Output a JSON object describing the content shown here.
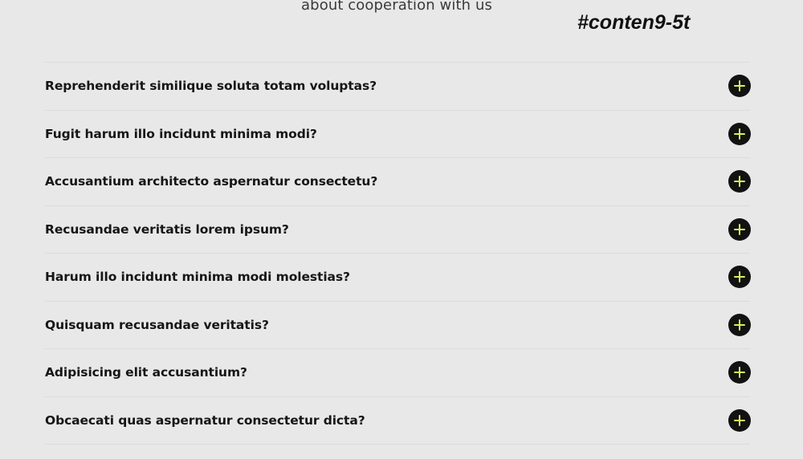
{
  "header": {
    "subtitle": "about cooperation with us",
    "section_tag": "#conten9-5t"
  },
  "faq": {
    "items": [
      {
        "question": "Reprehenderit similique soluta totam voluptas?",
        "icon": "plus-icon"
      },
      {
        "question": "Fugit harum illo incidunt minima modi?",
        "icon": "plus-icon"
      },
      {
        "question": "Accusantium architecto aspernatur consectetu?",
        "icon": "plus-icon"
      },
      {
        "question": "Recusandae veritatis lorem ipsum?",
        "icon": "plus-icon"
      },
      {
        "question": "Harum illo incidunt minima modi molestias?",
        "icon": "plus-icon"
      },
      {
        "question": "Quisquam recusandae veritatis?",
        "icon": "plus-icon"
      },
      {
        "question": "Adipisicing elit accusantium?",
        "icon": "plus-icon"
      },
      {
        "question": "Obcaecati quas aspernatur consectetur dicta?",
        "icon": "plus-icon"
      }
    ]
  },
  "colors": {
    "background": "#e8e8e8",
    "text": "#161616",
    "icon_bg": "#121212",
    "icon_accent": "#d6f25a",
    "divider": "#dcdcdc"
  }
}
